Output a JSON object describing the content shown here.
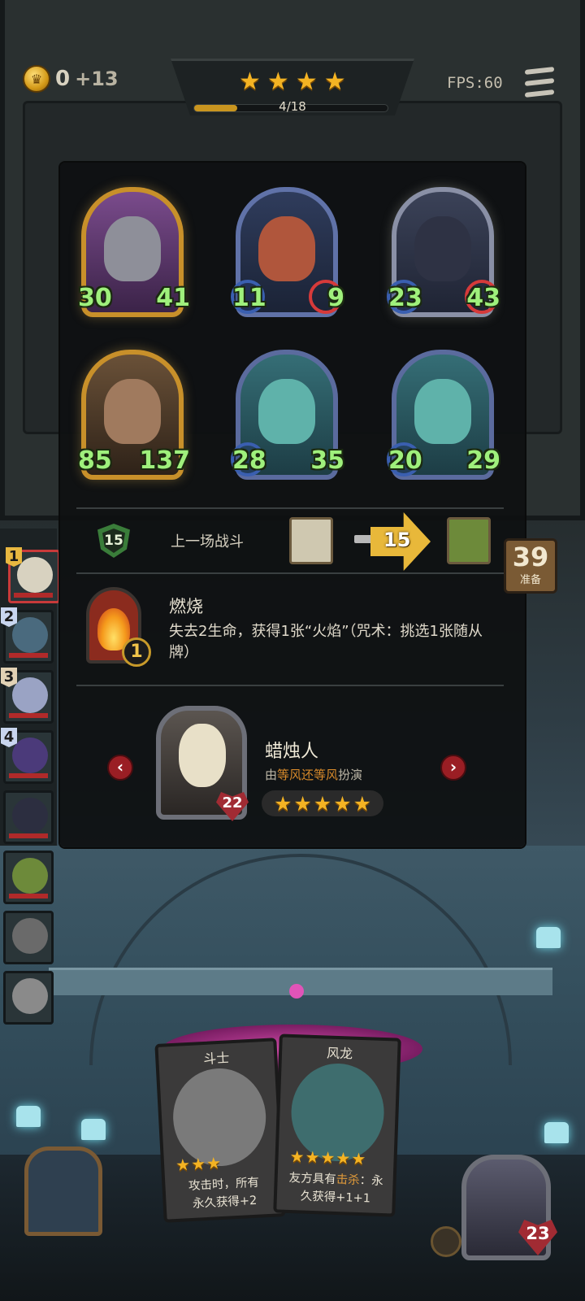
{
  "hud": {
    "gold": "0",
    "gold_income": "+13",
    "stars": 4,
    "progress_label": "4/18",
    "progress_fraction": 0.222,
    "fps": "FPS:60",
    "icons": {
      "coin": "crown-coin-icon",
      "menu": "hamburger-menu-icon"
    }
  },
  "board_units": [
    {
      "attack": "30",
      "health": "41",
      "frame": "gold"
    },
    {
      "attack": "11",
      "health": "9",
      "frame": "blue"
    },
    {
      "attack": "23",
      "health": "43",
      "frame": "silver"
    },
    {
      "attack": "85",
      "health": "137",
      "frame": "gold"
    },
    {
      "attack": "28",
      "health": "35",
      "frame": "blue"
    },
    {
      "attack": "20",
      "health": "29",
      "frame": "blue"
    }
  ],
  "last_battle": {
    "shield_value": "15",
    "label": "上一场战斗",
    "damage": "15"
  },
  "timer": {
    "value": "39",
    "label": "准备"
  },
  "skill": {
    "level": "1",
    "title": "燃烧",
    "description": "失去2生命，获得1张“火焰”（咒术：挑选1张随从牌）"
  },
  "hero": {
    "name": "蜡烛人",
    "by_prefix": "由",
    "by_player": "等风还等风",
    "by_suffix": "扮演",
    "health": "22",
    "stars": 5,
    "prev_icon": "‹",
    "next_icon": "›"
  },
  "roster": [
    {
      "num": "1"
    },
    {
      "num": "2"
    },
    {
      "num": "3"
    },
    {
      "num": "4"
    },
    {
      "num": ""
    },
    {
      "num": ""
    },
    {
      "num": ""
    },
    {
      "num": ""
    }
  ],
  "hand_cards": [
    {
      "title": "斗士",
      "desc_a": "攻击时，所有",
      "desc_b": "永久获得+2",
      "stars": 3
    },
    {
      "title": "风龙",
      "desc_a": "友方具有",
      "keyword": "击杀",
      "desc_a2": "：永",
      "desc_b": "久获得+1+1",
      "stars": 5
    }
  ],
  "player": {
    "health": "23"
  },
  "colors": {
    "star": "#f4b323",
    "stat_green": "#9ff07c",
    "keyword": "#e09a3a",
    "danger_red": "#a12b33"
  }
}
